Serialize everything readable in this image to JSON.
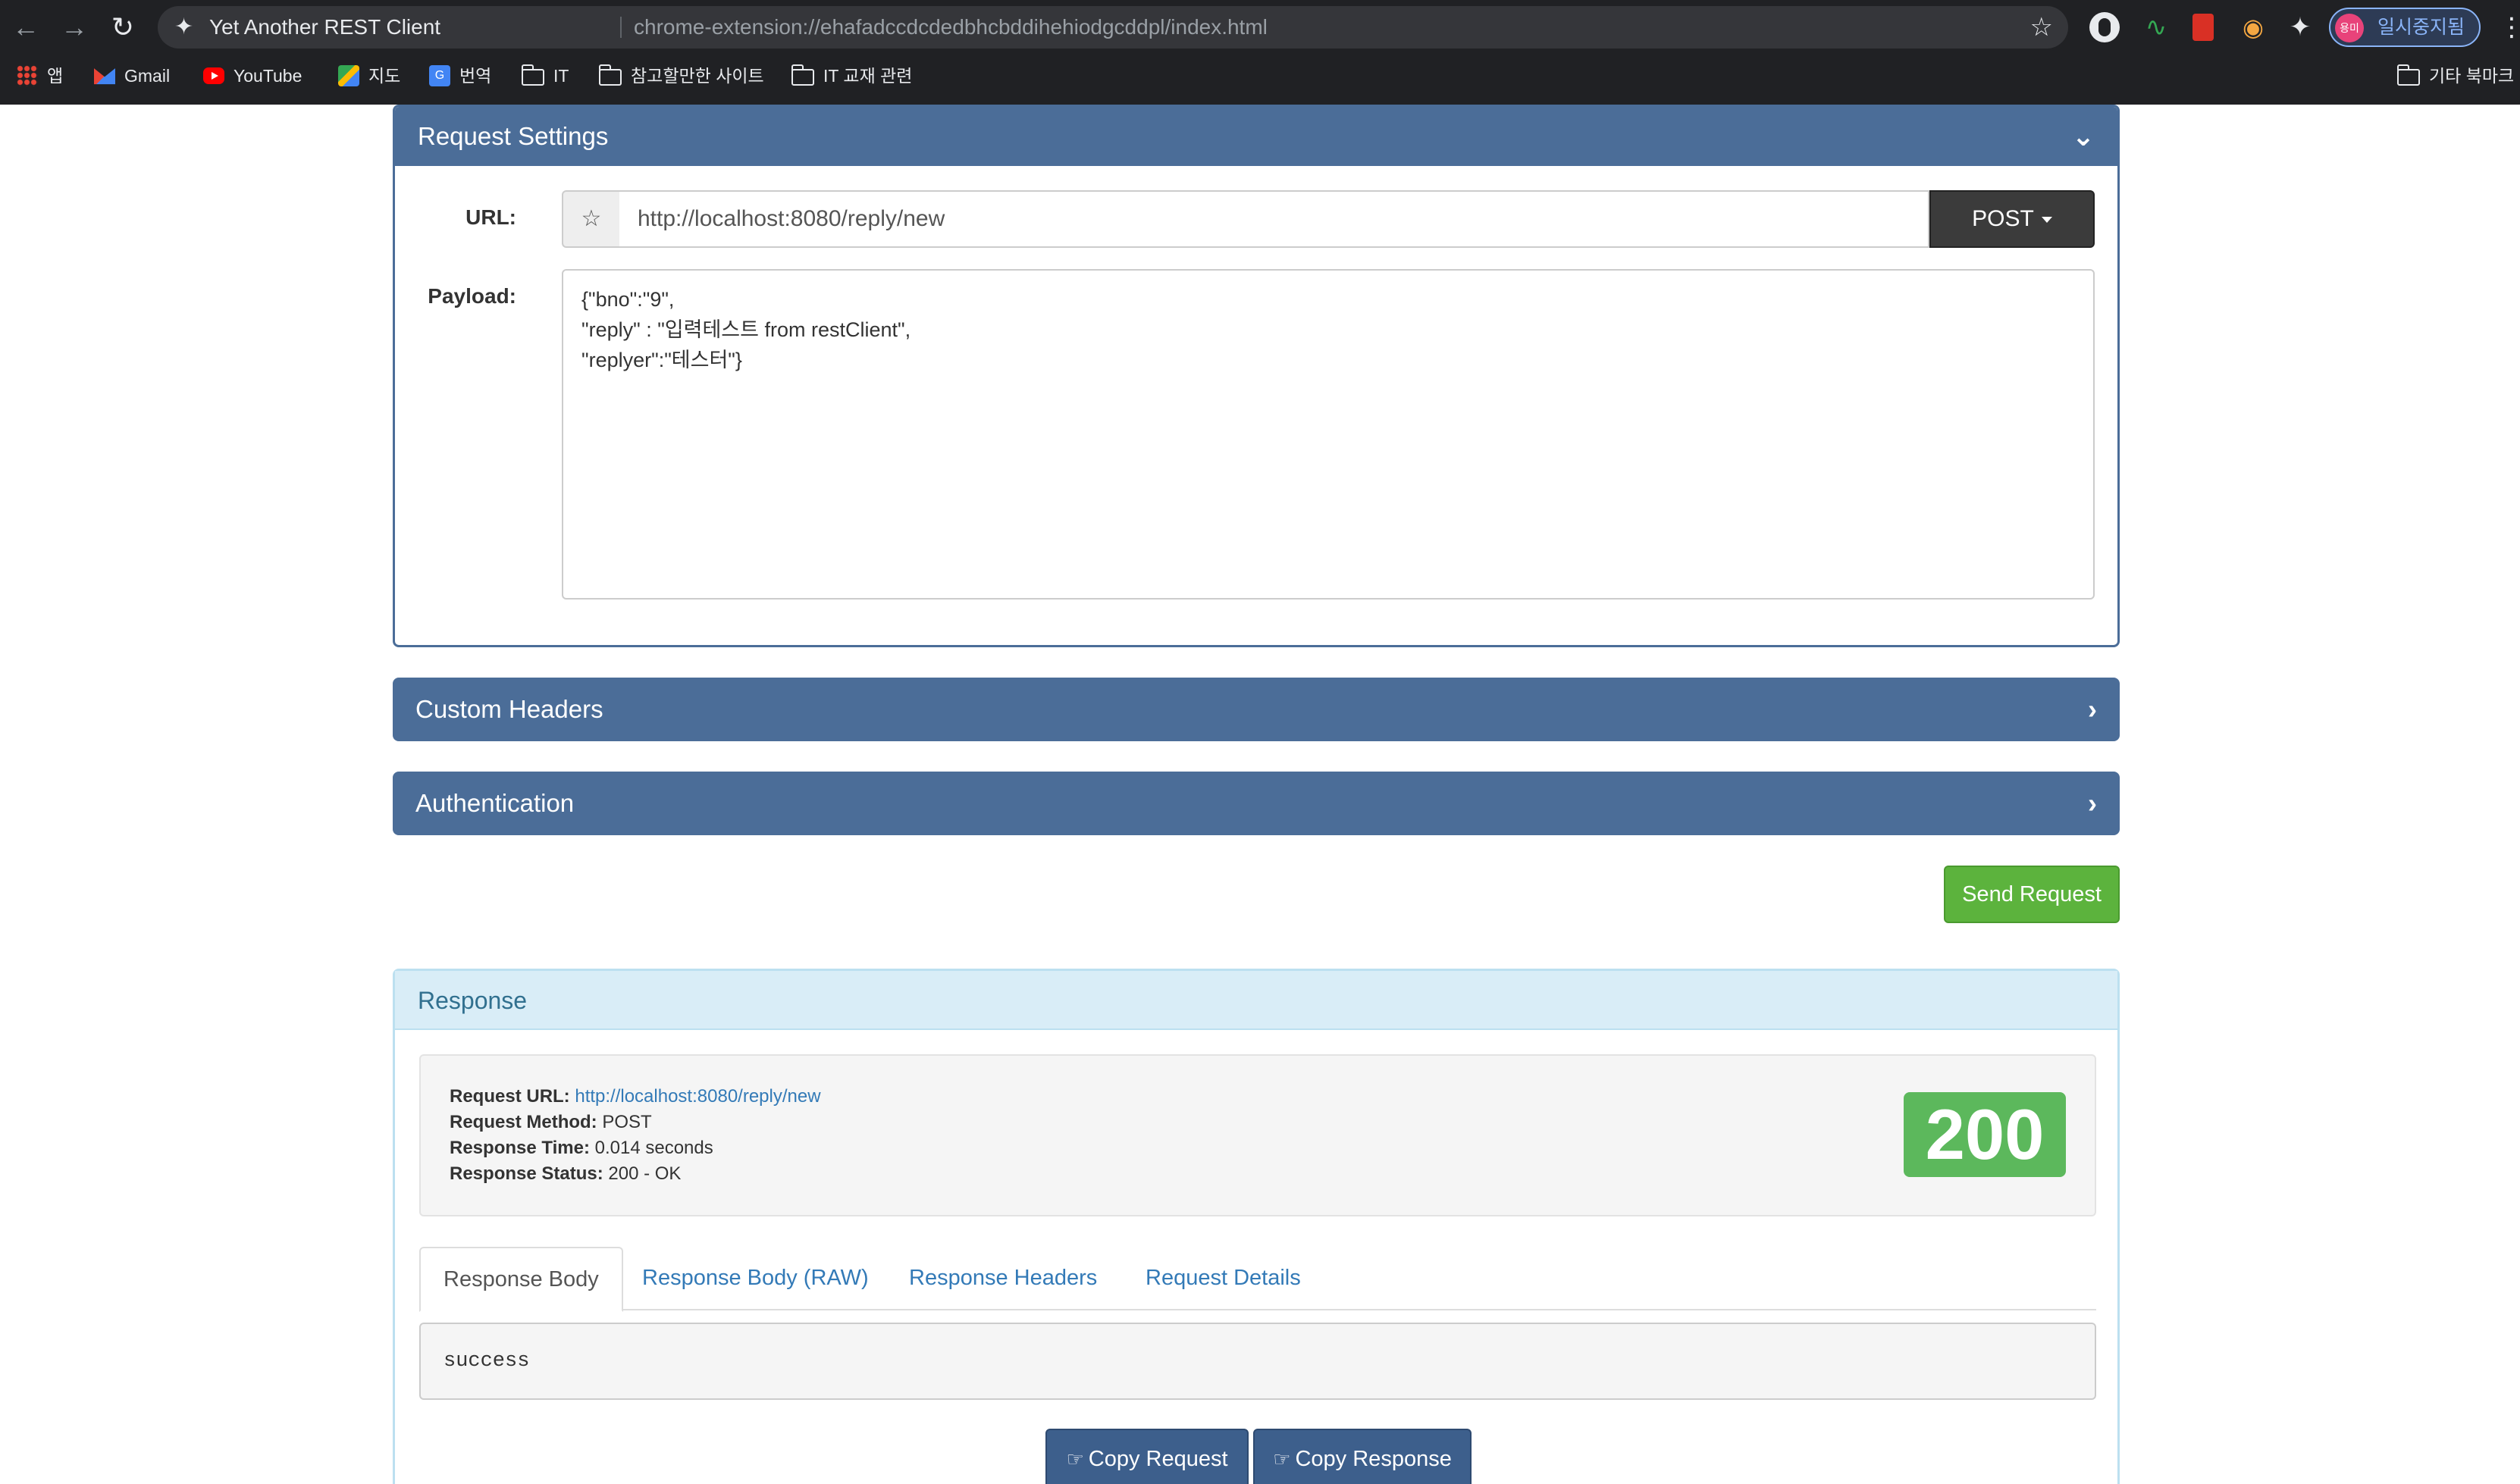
{
  "browser": {
    "tab_title": "Yet Another REST Client",
    "url": "chrome-extension://ehafadccdcdedbhcbddihehiodgcddpl/index.html",
    "profile_avatar_text": "용미",
    "profile_label": "일시중지됨",
    "bookmarks": [
      "앱",
      "Gmail",
      "YouTube",
      "지도",
      "번역",
      "IT",
      "참고할만한 사이트",
      "IT 교재 관련"
    ],
    "other_bookmarks": "기타 북마크"
  },
  "request": {
    "title": "Request Settings",
    "url_label": "URL:",
    "url_value": "http://localhost:8080/reply/new",
    "method": "POST",
    "payload_label": "Payload:",
    "payload": "{\"bno\":\"9\",\n\"reply\" : \"입력테스트 from restClient\",\n\"replyer\":\"테스터\"}"
  },
  "custom_headers": {
    "title": "Custom Headers"
  },
  "authentication": {
    "title": "Authentication"
  },
  "send_label": "Send Request",
  "response": {
    "title": "Response",
    "request_url_label": "Request URL:",
    "request_url": "http://localhost:8080/reply/new",
    "request_method_label": "Request Method:",
    "request_method": "POST",
    "response_time_label": "Response Time:",
    "response_time": "0.014 seconds",
    "response_status_label": "Response Status:",
    "response_status": "200 - OK",
    "status_code": "200",
    "tabs": [
      "Response Body",
      "Response Body (RAW)",
      "Response Headers",
      "Request Details"
    ],
    "body": "success",
    "copy_request": "Copy Request",
    "copy_response": "Copy Response"
  },
  "colors": {
    "panel_primary": "#4b6d98",
    "success": "#5cb85c",
    "info_bg": "#d9edf7",
    "link": "#337ab7"
  }
}
